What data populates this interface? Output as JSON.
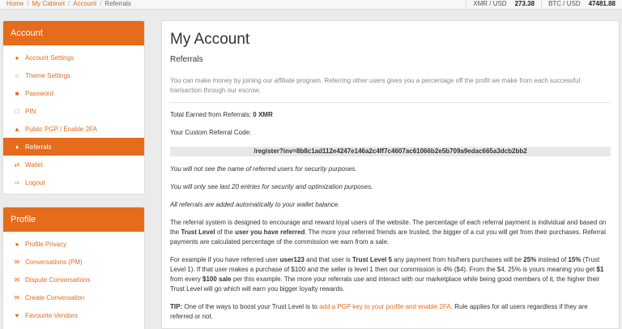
{
  "breadcrumb": [
    "Home",
    "My Cabinet",
    "Account",
    "Referrals"
  ],
  "rates": [
    {
      "label": "XMR / USD",
      "value": "273.38"
    },
    {
      "label": "BTC / USD",
      "value": "47481.88"
    }
  ],
  "account_panel": {
    "title": "Account",
    "items": [
      {
        "label": "Account Settings",
        "icon": "user-icon"
      },
      {
        "label": "Theme Settings",
        "icon": "lightbulb-icon"
      },
      {
        "label": "Password",
        "icon": "lock-icon"
      },
      {
        "label": "PIN",
        "icon": "unlock-icon"
      },
      {
        "label": "Public PGP / Enable 2FA",
        "icon": "shield-icon"
      },
      {
        "label": "Referrals",
        "icon": "link-icon",
        "active": true
      },
      {
        "label": "Wallet",
        "icon": "exchange-icon"
      },
      {
        "label": "Logout",
        "icon": "sign-out-icon"
      }
    ]
  },
  "profile_panel": {
    "title": "Profile",
    "items": [
      {
        "label": "Profile Privacy",
        "icon": "user-secret-icon"
      },
      {
        "label": "Conversations (PM)",
        "icon": "envelope-icon"
      },
      {
        "label": "Dispute Conversations",
        "icon": "envelope-icon"
      },
      {
        "label": "Create Conversation",
        "icon": "envelope-icon"
      },
      {
        "label": "Favourite Vendors",
        "icon": "heart-icon"
      }
    ]
  },
  "main": {
    "title": "My Account",
    "subtitle": "Referrals",
    "intro": "You can make money by joining our affiliate program. Referring other users gives you a percentage off the profit we make from each successful transaction through our escrow.",
    "total_label": "Total Earned from Referrals:",
    "total_value": "0 XMR",
    "code_label": "Your Custom Referral Code:",
    "code": "/register?inv=8b8c1ad112e4247e146a2c4ff7c4607ac61066b2e5b709a9edac665a3dcb2bb2",
    "note1": "You will not see the name of referred users for security purposes.",
    "note2": "You will only see last 20 entries for security and optimization purposes.",
    "note3": "All referrals are added automatically to your wallet balance.",
    "system": {
      "t1": "The referral system is designed to encourage and reward loyal users of the website. The percentage of each referral payment is individual and based on the ",
      "b1": "Trust Level",
      "t2": " of the ",
      "b2": "user you have referred",
      "t3": ". The more your referred friends are trusted, the bigger of a cut you will get from their purchases. Referral payments are calculated percentage of the commission we earn from a sale."
    },
    "example": {
      "t1": "For example if you have referred user ",
      "b1": "user123",
      "t2": " and that user is ",
      "b2": "Trust Level 5",
      "t3": " any payment from his/hers purchases will be ",
      "b3": "25%",
      "t4": " instead of ",
      "b4": "15%",
      "t5": " (Trust Level 1). If that user makes a purchase of $100 and the seller is level 1 then our commission is 4% ($4). From the $4, 25% is yours meaning you get ",
      "b5": "$1",
      "t6": " from every ",
      "b6": "$100 sale",
      "t7": " per this example. The more your referrals use and interact with our marketplace while being good members of it, the higher their Trust Level will go which will earn you bigger loyalty rewards."
    },
    "tip": {
      "label": "TIP:",
      "t1": " One of the ways to boost your Trust Level is to ",
      "link": "add a PGP key to your profile and enable 2FA",
      "t2": ". Rule applies for all users regardless if they are referred or not."
    }
  }
}
